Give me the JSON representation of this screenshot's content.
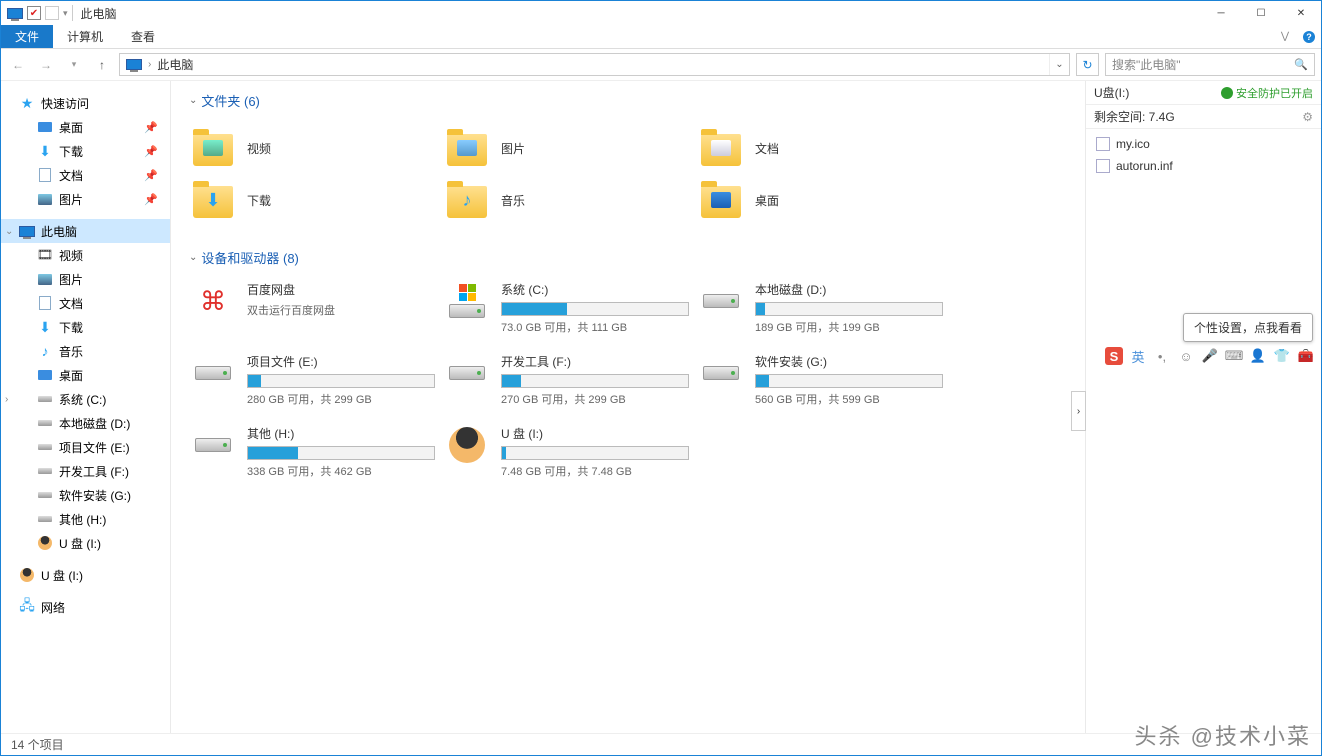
{
  "title": "此电脑",
  "ribbon": {
    "file": "文件",
    "computer": "计算机",
    "view": "查看"
  },
  "nav": {
    "location": "此电脑",
    "search_placeholder": "搜索\"此电脑\""
  },
  "sidebar": {
    "quick": "快速访问",
    "quick_items": [
      "桌面",
      "下载",
      "文档",
      "图片"
    ],
    "this_pc": "此电脑",
    "pc_items": [
      "视频",
      "图片",
      "文档",
      "下载",
      "音乐",
      "桌面",
      "系统 (C:)",
      "本地磁盘 (D:)",
      "项目文件 (E:)",
      "开发工具 (F:)",
      "软件安装 (G:)",
      "其他 (H:)",
      "U 盘 (I:)"
    ],
    "usb": "U 盘 (I:)",
    "network": "网络"
  },
  "sections": {
    "folders_hdr": "文件夹 (6)",
    "drives_hdr": "设备和驱动器 (8)"
  },
  "folders": [
    {
      "label": "视频",
      "key": "video"
    },
    {
      "label": "图片",
      "key": "pictures"
    },
    {
      "label": "文档",
      "key": "documents"
    },
    {
      "label": "下载",
      "key": "downloads"
    },
    {
      "label": "音乐",
      "key": "music"
    },
    {
      "label": "桌面",
      "key": "desktop"
    }
  ],
  "drives": [
    {
      "name": "百度网盘",
      "sub": "双击运行百度网盘",
      "type": "app",
      "fill": 0
    },
    {
      "name": "系统 (C:)",
      "sub": "73.0 GB 可用，共 111 GB",
      "type": "win",
      "fill": 35
    },
    {
      "name": "本地磁盘 (D:)",
      "sub": "189 GB 可用，共 199 GB",
      "type": "hdd",
      "fill": 5
    },
    {
      "name": "项目文件 (E:)",
      "sub": "280 GB 可用，共 299 GB",
      "type": "hdd",
      "fill": 7
    },
    {
      "name": "开发工具 (F:)",
      "sub": "270 GB 可用，共 299 GB",
      "type": "hdd",
      "fill": 10
    },
    {
      "name": "软件安装 (G:)",
      "sub": "560 GB 可用，共 599 GB",
      "type": "hdd",
      "fill": 7
    },
    {
      "name": "其他 (H:)",
      "sub": "338 GB 可用，共 462 GB",
      "type": "hdd",
      "fill": 27
    },
    {
      "name": "U 盘 (I:)",
      "sub": "7.48 GB 可用，共 7.48 GB",
      "type": "usb",
      "fill": 2
    }
  ],
  "rpane": {
    "title": "U盘(I:)",
    "protect": "安全防护已开启",
    "space": "剩余空间: 7.4G",
    "files": [
      "my.ico",
      "autorun.inf"
    ]
  },
  "ime": {
    "tip": "个性设置，点我看看",
    "lang": "英"
  },
  "status": "14 个项目",
  "watermark": "头杀 @技术小菜"
}
